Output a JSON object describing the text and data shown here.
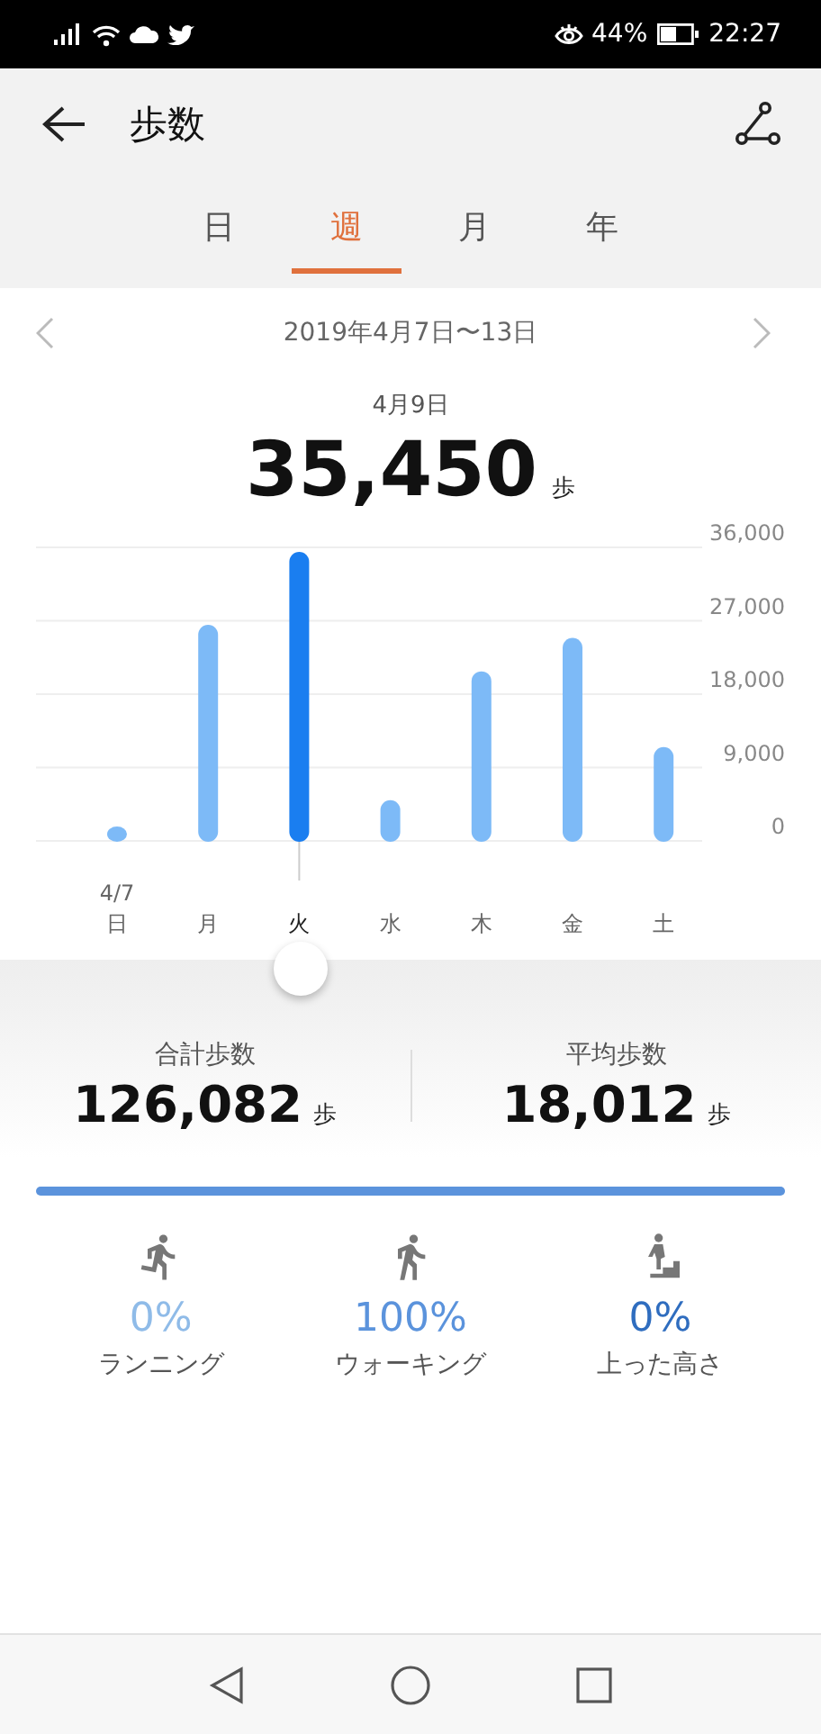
{
  "status_bar": {
    "battery": "44%",
    "time": "22:27"
  },
  "header": {
    "title": "歩数"
  },
  "tabs": [
    {
      "label": "日",
      "selected": false
    },
    {
      "label": "週",
      "selected": true
    },
    {
      "label": "月",
      "selected": false
    },
    {
      "label": "年",
      "selected": false
    }
  ],
  "range": {
    "label": "2019年4月7日〜13日"
  },
  "summary": {
    "date": "4月9日",
    "value": "35,450",
    "unit": "歩"
  },
  "chart": {
    "chart_data": {
      "type": "bar",
      "grid": true,
      "categories": [
        "日",
        "月",
        "火",
        "水",
        "木",
        "金",
        "土"
      ],
      "values": [
        1500,
        26500,
        35450,
        5000,
        20800,
        24900,
        11500
      ],
      "ylim": [
        0,
        36000
      ],
      "yticks": [
        {
          "value": 0,
          "label": "0"
        },
        {
          "value": 9000,
          "label": "9,000"
        },
        {
          "value": 18000,
          "label": "18,000"
        },
        {
          "value": 27000,
          "label": "27,000"
        },
        {
          "value": 36000,
          "label": "36,000"
        }
      ]
    },
    "days": [
      {
        "date": "4/7",
        "selected": false
      },
      {
        "selected": false
      },
      {
        "selected": true
      },
      {
        "selected": false
      },
      {
        "selected": false
      },
      {
        "selected": false
      },
      {
        "selected": false
      }
    ]
  },
  "stats": [
    {
      "label": "合計歩数",
      "value": "126,082",
      "unit": "歩"
    },
    {
      "label": "平均歩数",
      "value": "18,012",
      "unit": "歩"
    }
  ],
  "activities": [
    {
      "kind": "running",
      "percent": "0%",
      "label": "ランニング",
      "color": "#8fbbe8"
    },
    {
      "kind": "walking",
      "percent": "100%",
      "label": "ウォーキング",
      "color": "#5b93dc",
      "level": 1
    },
    {
      "kind": "climbing",
      "percent": "0%",
      "label": "上った高さ",
      "color": "#2f6dbf"
    }
  ]
}
